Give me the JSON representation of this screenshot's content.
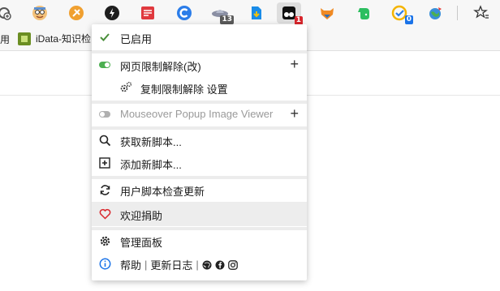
{
  "toolbar": {
    "partial_left_label": "",
    "extensions": [
      {
        "name": "avatar-extension",
        "badge": ""
      },
      {
        "name": "tampermonkey-orange",
        "badge": ""
      },
      {
        "name": "dark-circle-extension",
        "badge": ""
      },
      {
        "name": "red-notes-extension",
        "badge": ""
      },
      {
        "name": "blue-c-extension",
        "badge": ""
      },
      {
        "name": "ufo-extension",
        "badge": "13"
      },
      {
        "name": "file-download-extension",
        "badge": ""
      },
      {
        "name": "tampermonkey-extension",
        "badge": "1"
      },
      {
        "name": "fox-extension",
        "badge": ""
      },
      {
        "name": "evernote-extension",
        "badge": ""
      },
      {
        "name": "todo-extension",
        "badge": "0"
      },
      {
        "name": "earth-extension",
        "badge": ""
      }
    ],
    "badge_colors": {
      "dark": "#5a5a5a",
      "red": "#d9262c",
      "blue": "#1a73e8"
    }
  },
  "bookmarks": {
    "left_partial": "用",
    "item_label": "iData-知识检"
  },
  "menu": {
    "enabled_label": "已启用",
    "scripts": [
      {
        "label": "网页限制解除(改)",
        "enabled": true,
        "toggle_color": "#4caf50"
      },
      {
        "label": "复制限制解除 设置",
        "enabled": true
      },
      {
        "label": "Mouseover Popup Image Viewer",
        "enabled": false,
        "toggle_color": "#b0b0b0"
      }
    ],
    "plus_symbol": "+",
    "actions": [
      {
        "label": "获取新脚本..."
      },
      {
        "label": "添加新脚本..."
      }
    ],
    "update_check": "用户脚本检查更新",
    "donate": "欢迎捐助",
    "dashboard": "管理面板",
    "help": "帮助",
    "changelog": "更新日志",
    "separator": "|",
    "accent_check_color": "#4a8f3b",
    "donate_heart_color": "#d9262c",
    "info_color": "#1a73e8"
  }
}
